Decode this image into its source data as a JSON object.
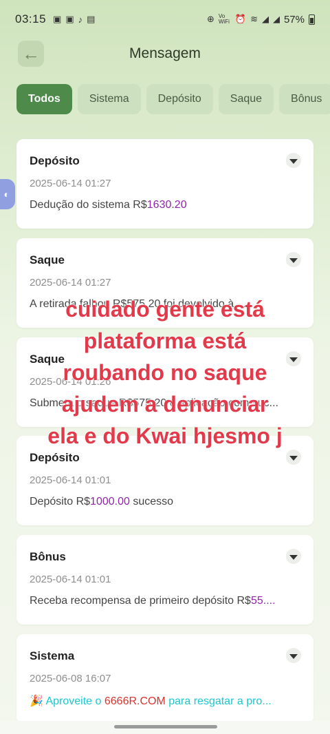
{
  "status_bar": {
    "time": "03:15",
    "battery": "57%",
    "icons_left": [
      "msg-icon",
      "chat-icon",
      "tiktok-icon",
      "gallery-icon"
    ],
    "icons_right": [
      "sync-icon",
      "vowifi-icon",
      "alarm-icon",
      "wifi-icon",
      "signal-icon",
      "signal-icon",
      "battery-icon"
    ],
    "vowifi": "Vo WiFi"
  },
  "header": {
    "title": "Mensagem",
    "back_icon": "arrow-left-icon"
  },
  "tabs": [
    {
      "label": "Todos",
      "active": true
    },
    {
      "label": "Sistema",
      "active": false
    },
    {
      "label": "Depósito",
      "active": false
    },
    {
      "label": "Saque",
      "active": false
    },
    {
      "label": "Bônus",
      "active": false
    }
  ],
  "messages": [
    {
      "title": "Depósito",
      "date": "2025-06-14 01:27",
      "text": "Dedução do sistema R$",
      "amount": "1630.20",
      "suffix": ""
    },
    {
      "title": "Saque",
      "date": "2025-06-14 01:27",
      "text": "A retirada falhou R$575.20 foi devolvido à ...",
      "amount": "",
      "suffix": ""
    },
    {
      "title": "Saque",
      "date": "2025-06-14 01:26",
      "text": "Submeta o saque R$575.20 e aplicação com suc...",
      "amount": "",
      "suffix": ""
    },
    {
      "title": "Depósito",
      "date": "2025-06-14 01:01",
      "text": "Depósito R$",
      "amount": "1000.00",
      "suffix": " sucesso"
    },
    {
      "title": "Bônus",
      "date": "2025-06-14 01:01",
      "text": "Receba recompensa de primeiro depósito R$",
      "amount": "55....",
      "suffix": ""
    },
    {
      "title": "Sistema",
      "date": "2025-06-08 16:07",
      "emoji": "🎉",
      "text_a": "Aproveite o ",
      "site": "6666R.COM",
      "text_b": " para resgatar a pro..."
    }
  ],
  "overlay_text": [
    "cuidado gente está",
    "plataforma está",
    "roubando no saque",
    "ajudem a denunciar",
    "ela e do Kwai hjesmo j"
  ],
  "colors": {
    "accent": "#4e8b4b",
    "amount": "#8e27a8",
    "overlay": "#e23a4b"
  }
}
